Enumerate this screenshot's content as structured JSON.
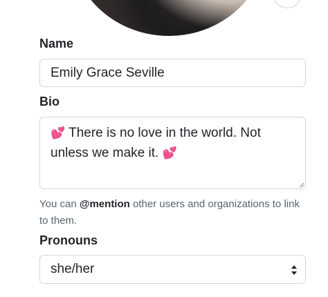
{
  "profile": {
    "name_label": "Name",
    "name_value": "Emily Grace Seville",
    "bio_label": "Bio",
    "bio_emoji": "💕",
    "bio_text": "There is no love in the world. Not unless we make it.",
    "hint_prefix": "You can ",
    "hint_mention": "@mention",
    "hint_suffix": " other users and organizations to link to them.",
    "pronouns_label": "Pronouns",
    "pronouns_value": "she/her"
  },
  "icons": {
    "avatar": "avatar-image",
    "avatar_edit": "edit-avatar-icon",
    "resize": "resize-grip-icon",
    "select": "select-arrows-icon"
  },
  "colors": {
    "heart": "#e0245e",
    "border": "#d0d7de",
    "muted_text": "#59636e"
  }
}
